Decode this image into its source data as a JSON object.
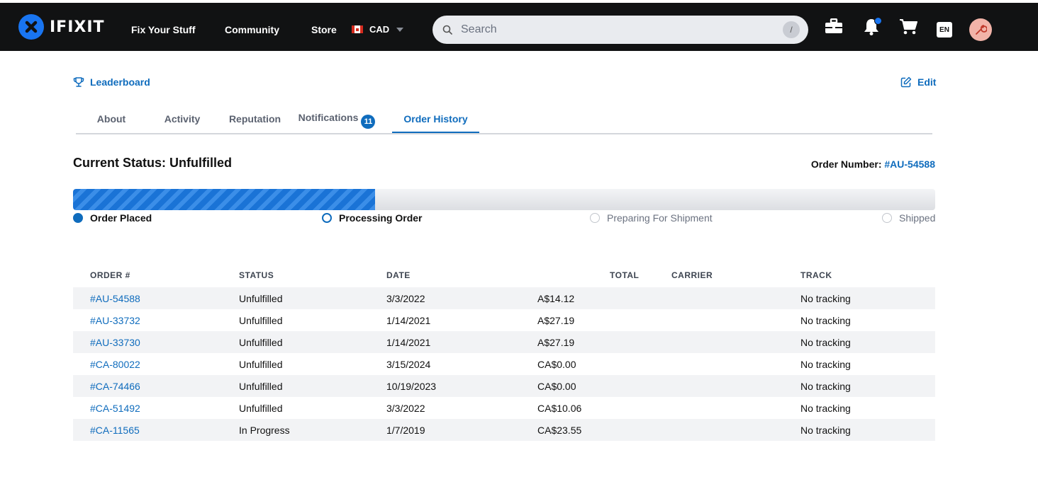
{
  "header": {
    "logo_text": "IFIXIT",
    "nav": [
      "Fix Your Stuff",
      "Community",
      "Store"
    ],
    "currency": "CAD",
    "search_placeholder": "Search",
    "search_shortcut": "/",
    "language": "EN"
  },
  "profile": {
    "leaderboard_label": "Leaderboard",
    "edit_label": "Edit",
    "tabs": [
      {
        "label": "About"
      },
      {
        "label": "Activity"
      },
      {
        "label": "Reputation"
      },
      {
        "label": "Notifications",
        "badge": "11"
      },
      {
        "label": "Order History",
        "active": true
      }
    ]
  },
  "order_status": {
    "title": "Current Status: Unfulfilled",
    "order_number_label": "Order Number:",
    "order_number": "#AU-54588",
    "progress_percent": 35,
    "steps": [
      {
        "label": "Order Placed",
        "state": "done"
      },
      {
        "label": "Processing Order",
        "state": "current"
      },
      {
        "label": "Preparing For Shipment",
        "state": "pending"
      },
      {
        "label": "Shipped",
        "state": "pending"
      }
    ]
  },
  "orders_table": {
    "columns": [
      "ORDER #",
      "STATUS",
      "DATE",
      "TOTAL",
      "CARRIER",
      "TRACK"
    ],
    "rows": [
      {
        "order": "#AU-54588",
        "status": "Unfulfilled",
        "date": "3/3/2022",
        "total": "A$14.12",
        "carrier": "",
        "track": "No tracking"
      },
      {
        "order": "#AU-33732",
        "status": "Unfulfilled",
        "date": "1/14/2021",
        "total": "A$27.19",
        "carrier": "",
        "track": "No tracking"
      },
      {
        "order": "#AU-33730",
        "status": "Unfulfilled",
        "date": "1/14/2021",
        "total": "A$27.19",
        "carrier": "",
        "track": "No tracking"
      },
      {
        "order": "#CA-80022",
        "status": "Unfulfilled",
        "date": "3/15/2024",
        "total": "CA$0.00",
        "carrier": "",
        "track": "No tracking"
      },
      {
        "order": "#CA-74466",
        "status": "Unfulfilled",
        "date": "10/19/2023",
        "total": "CA$0.00",
        "carrier": "",
        "track": "No tracking"
      },
      {
        "order": "#CA-51492",
        "status": "Unfulfilled",
        "date": "3/3/2022",
        "total": "CA$10.06",
        "carrier": "",
        "track": "No tracking"
      },
      {
        "order": "#CA-11565",
        "status": "In Progress",
        "date": "1/7/2019",
        "total": "CA$23.55",
        "carrier": "",
        "track": "No tracking"
      }
    ]
  },
  "colors": {
    "accent": "#0f6cbd",
    "topbar": "#111213",
    "brand_blue": "#1975f1"
  },
  "icons": [
    "ifixit-logo-icon",
    "canada-flag-icon",
    "chevron-down-icon",
    "search-icon",
    "toolbox-icon",
    "bell-icon",
    "cart-icon",
    "wrench-icon",
    "trophy-icon",
    "edit-icon"
  ]
}
